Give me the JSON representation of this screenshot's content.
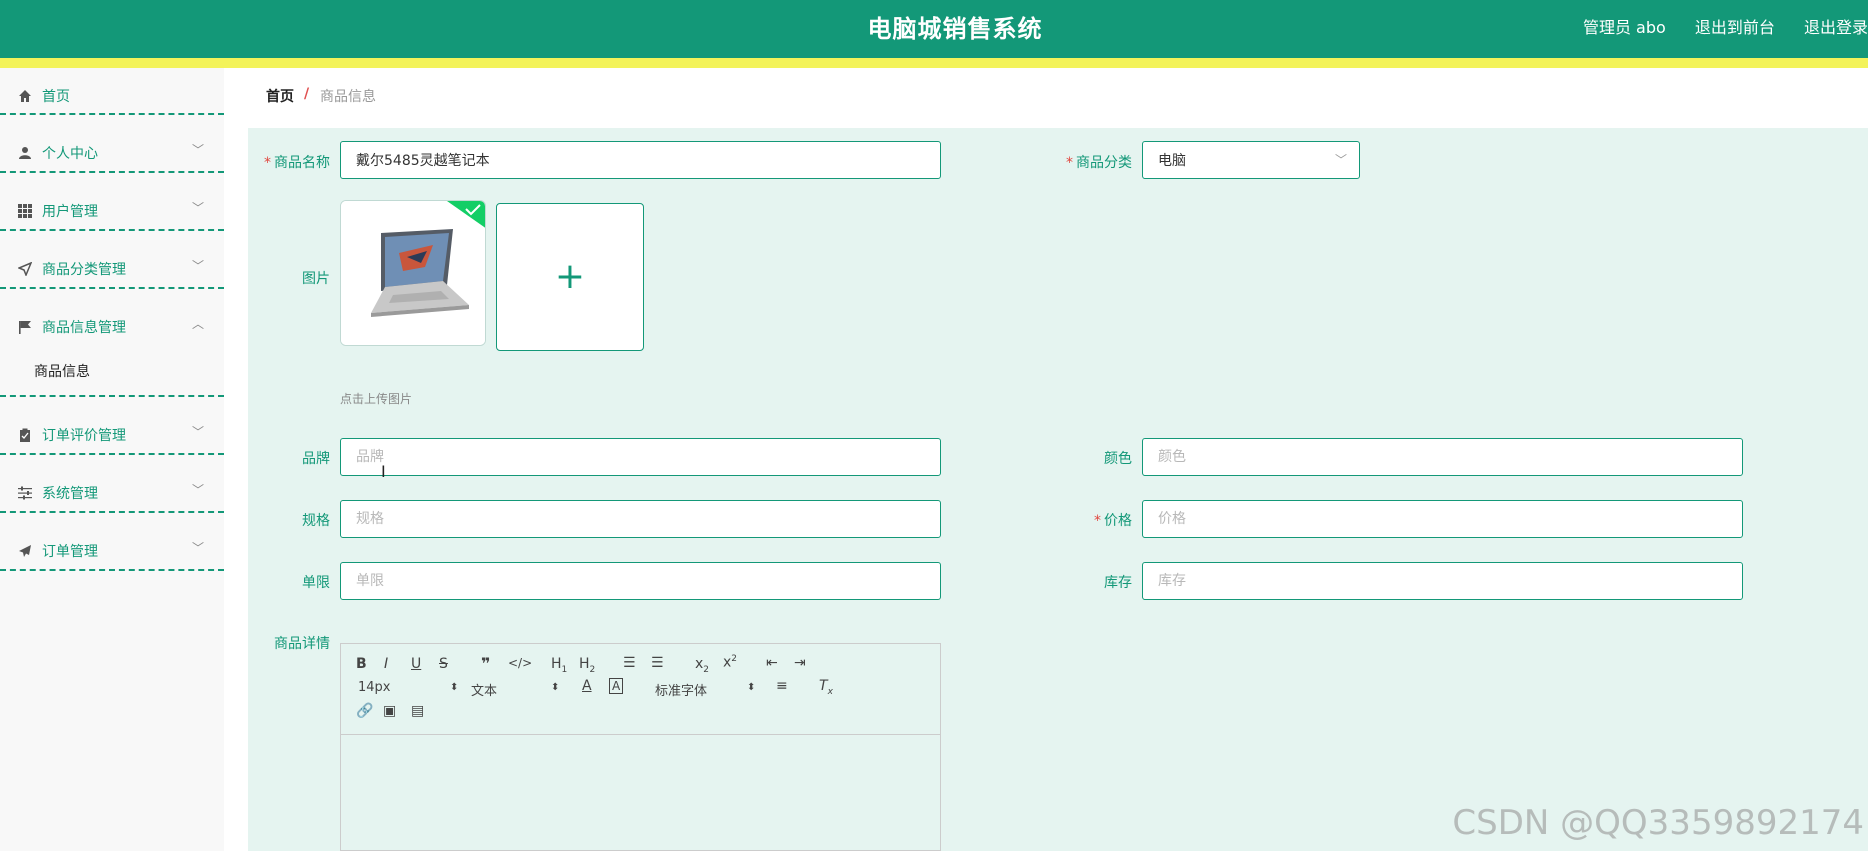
{
  "header": {
    "title": "电脑城销售系统",
    "user": "管理员 abo",
    "exit_front": "退出到前台",
    "logout": "退出登录",
    "bg_color": "#139878",
    "stripe_color": "#f3f35a"
  },
  "sidebar": {
    "items": [
      {
        "label": "首页",
        "icon": "home-icon"
      },
      {
        "label": "个人中心",
        "icon": "user-icon"
      },
      {
        "label": "用户管理",
        "icon": "grid-icon"
      },
      {
        "label": "商品分类管理",
        "icon": "send-icon"
      },
      {
        "label": "商品信息管理",
        "icon": "flag-icon",
        "expanded": true,
        "children": [
          {
            "label": "商品信息"
          }
        ]
      },
      {
        "label": "订单评价管理",
        "icon": "clipboard-icon"
      },
      {
        "label": "系统管理",
        "icon": "sliders-icon"
      },
      {
        "label": "订单管理",
        "icon": "paper-plane-icon"
      }
    ]
  },
  "breadcrumb": {
    "home": "首页",
    "separator": "/",
    "current": "商品信息"
  },
  "form": {
    "name": {
      "label": "商品名称",
      "value": "戴尔5485灵越笔记本",
      "required": true
    },
    "category": {
      "label": "商品分类",
      "value": "电脑",
      "required": true
    },
    "image": {
      "label": "图片",
      "hint": "点击上传图片",
      "uploaded": true
    },
    "brand": {
      "label": "品牌",
      "placeholder": "品牌",
      "value": ""
    },
    "color": {
      "label": "颜色",
      "placeholder": "颜色",
      "value": ""
    },
    "spec": {
      "label": "规格",
      "placeholder": "规格",
      "value": ""
    },
    "price": {
      "label": "价格",
      "placeholder": "价格",
      "value": "",
      "required": true
    },
    "limit": {
      "label": "单限",
      "placeholder": "单限",
      "value": ""
    },
    "stock": {
      "label": "库存",
      "placeholder": "库存",
      "value": ""
    },
    "detail": {
      "label": "商品详情"
    }
  },
  "editor": {
    "font_size": "14px",
    "block_type": "文本",
    "font_family": "标准字体"
  },
  "watermark": "CSDN @QQ3359892174"
}
